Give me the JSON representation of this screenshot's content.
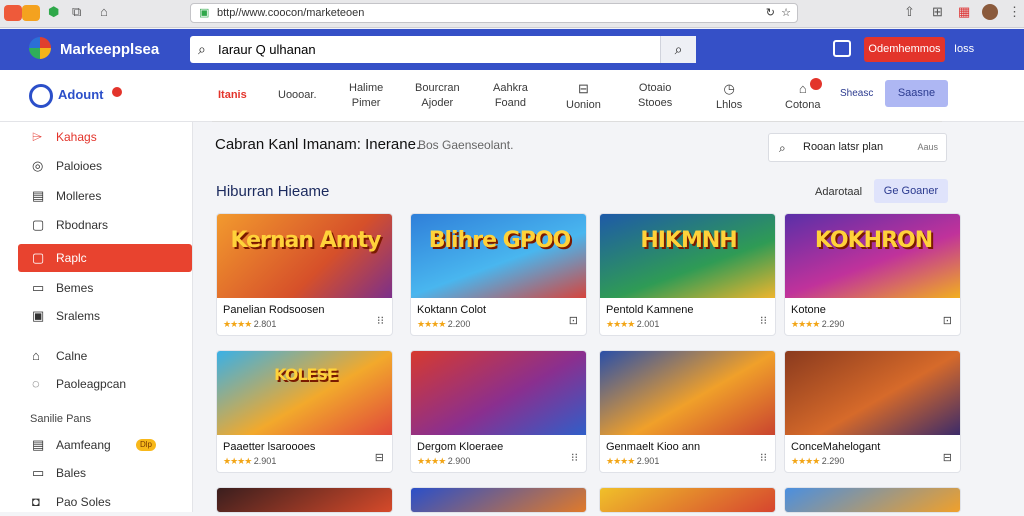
{
  "browser": {
    "url": "bttp//www.coocon/marketeoen"
  },
  "header": {
    "brand": "Markeepplsea",
    "search_value": "Iaraur Q ulhanan",
    "cta": "Odemhemmos",
    "link": "Ioss"
  },
  "account": {
    "label": "Adount"
  },
  "nav": {
    "items": [
      {
        "line1": "Itanis",
        "line2": ""
      },
      {
        "line1": "Uoooar.",
        "line2": ""
      },
      {
        "line1": "Halime",
        "line2": "Pimer"
      },
      {
        "line1": "Bourcran",
        "line2": "Ajoder"
      },
      {
        "line1": "Aahkra",
        "line2": "Foand"
      },
      {
        "line1": "",
        "line2": "Uonion"
      },
      {
        "line1": "Otoaio",
        "line2": "Stooes"
      },
      {
        "line1": "",
        "line2": "Lhlos"
      },
      {
        "line1": "",
        "line2": "Cotona"
      }
    ],
    "extra": "Sheasc",
    "cta": "Saasne"
  },
  "sidebar": {
    "items": [
      {
        "label": "Kahags",
        "icon": "tag-icon"
      },
      {
        "label": "Paloioes",
        "icon": "compass-icon"
      },
      {
        "label": "Molleres",
        "icon": "document-icon"
      },
      {
        "label": "Rbodnars",
        "icon": "box-icon"
      },
      {
        "label": "Raplc",
        "icon": "home-icon"
      },
      {
        "label": "Bemes",
        "icon": "page-icon"
      },
      {
        "label": "Sralems",
        "icon": "doc-icon"
      },
      {
        "label": "Calne",
        "icon": "house-icon"
      },
      {
        "label": "Paoleagpcan",
        "icon": "message-icon"
      }
    ],
    "section_head": "Sanilie Pans",
    "items2": [
      {
        "label": "Aamfeang",
        "icon": "card-icon",
        "badge": "Dlp"
      },
      {
        "label": "Bales",
        "icon": "page-icon"
      },
      {
        "label": "Pao Soles",
        "icon": "lock-icon"
      }
    ]
  },
  "main": {
    "title": "Cabran Kanl Imanam: Inerane.",
    "subtitle": "Bos Gaenseolant.",
    "search_value": "Rooan latsr plan",
    "search_hint": "Aaus",
    "section_title": "Hiburran Hieame",
    "section_link": "Adarotaal",
    "section_btn": "Ge Goaner"
  },
  "cards": [
    {
      "art": "Kernan Amty",
      "name": "Panelian Rodsoosen",
      "rating": "2.801"
    },
    {
      "art": "Blihre GPOO",
      "name": "Koktann Colot",
      "rating": "2.200"
    },
    {
      "art": "HIKMNH",
      "name": "Pentold Kamnene",
      "rating": "2.001"
    },
    {
      "art": "KOKHRON",
      "name": "Kotone",
      "rating": "2.290"
    },
    {
      "art": "KOLESE",
      "name": "Paaetter lsaroooes",
      "rating": "2.901"
    },
    {
      "art": "",
      "name": "Dergom Kloeraee",
      "rating": "2.900"
    },
    {
      "art": "",
      "name": "Genmaelt Kioo ann",
      "rating": "2.901"
    },
    {
      "art": "",
      "name": "ConceMahelogant",
      "rating": "2.290"
    }
  ],
  "colors": {
    "header_bg": "#3550c7",
    "accent_red": "#e3342b",
    "active_side": "#e8432f"
  }
}
